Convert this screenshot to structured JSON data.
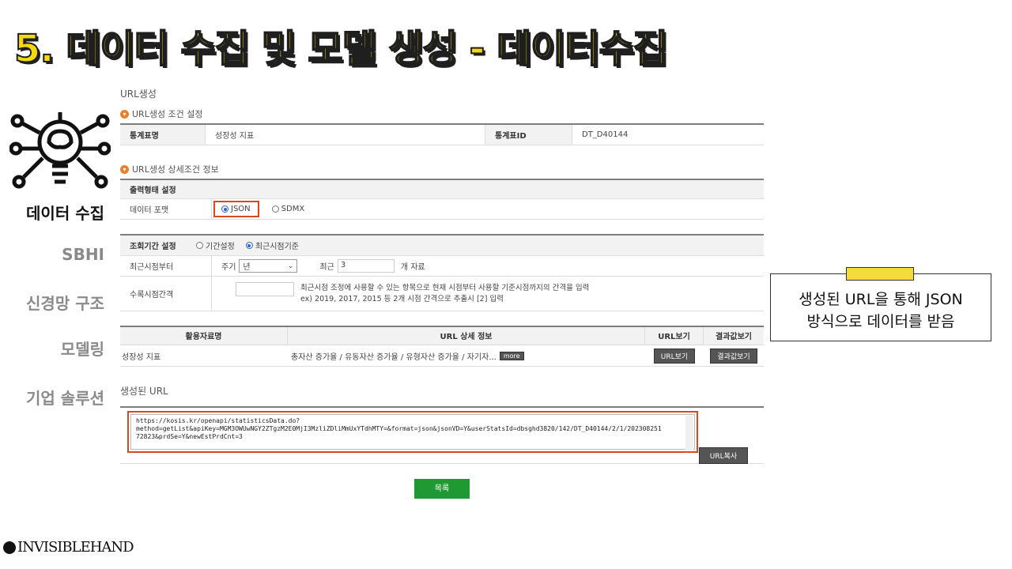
{
  "slide": {
    "title": "5. 데이터 수집 및 모델 생성 - 데이터수집",
    "logo_text": "INVISIBLEHAND"
  },
  "nav": {
    "items": [
      {
        "label": "데이터 수집",
        "active": true
      },
      {
        "label": "SBHI",
        "active": false
      },
      {
        "label": "신경망 구조",
        "active": false
      },
      {
        "label": "모델링",
        "active": false
      },
      {
        "label": "기업 솔루션",
        "active": false
      }
    ],
    "icon": "brain-lightbulb-icon"
  },
  "panel": {
    "heading": "URL생성",
    "cond_title": "URL생성 조건 설정",
    "stat_table_label": "통계표명",
    "stat_table_value": "성장성 지표",
    "stat_id_label": "통계표ID",
    "stat_id_value": "DT_D40144",
    "detail_title": "URL생성 상세조건 정보",
    "output_title": "출력형태 설정",
    "format_label": "데이터 포맷",
    "format_json": "JSON",
    "format_sdmx": "SDMX",
    "period_title": "조회기간 설정",
    "period_opt1": "기간설정",
    "period_opt2": "최근시점기준",
    "recent_label": "최근시점부터",
    "cycle_label": "주기",
    "cycle_value": "년",
    "recent_n_label": "최근",
    "recent_n_value": "3",
    "recent_unit": "개 자료",
    "interval_label": "수록시점간격",
    "interval_desc1": "최근시점 조정에 사용할 수 있는 항목으로 현재 시점부터 사용할 기준시점까지의 간격을 입력",
    "interval_desc2": "ex) 2019, 2017, 2015 등 2개 시점 간격으로 추출시 [2] 입력",
    "res_col1": "활용자료명",
    "res_col2": "URL 상세 정보",
    "res_col3": "URL보기",
    "res_col4": "결과값보기",
    "res_row_name": "성장성 지표",
    "res_row_detail": "총자산 증가율 / 유동자산 증가율 / 유형자산 증가율 / 자기자...",
    "more_label": "more",
    "url_view_btn": "URL보기",
    "result_view_btn": "결과값보기",
    "generated_url_title": "생성된 URL",
    "generated_url": "https://kosis.kr/openapi/statisticsData.do?\nmethod=getList&apiKey=MGM3OWUwNGY2ZTgzM2E0MjI3MzliZDliMmUxYTdhMTY=&format=json&jsonVD=Y&userStatsId=dbsghd3820/142/DT_D40144/2/1/202308251\n72823&prdSe=Y&newEstPrdCnt=3",
    "copy_btn": "URL복사",
    "list_btn": "목록"
  },
  "callout": {
    "line1": "생성된 URL을 통해 JSON",
    "line2": "방식으로 데이터를 받음"
  },
  "colors": {
    "title_yellow": "#f5d90f",
    "highlight_red": "#d9491f",
    "button_green": "#1f9a33",
    "callout_yellow": "#f5dc3c"
  }
}
